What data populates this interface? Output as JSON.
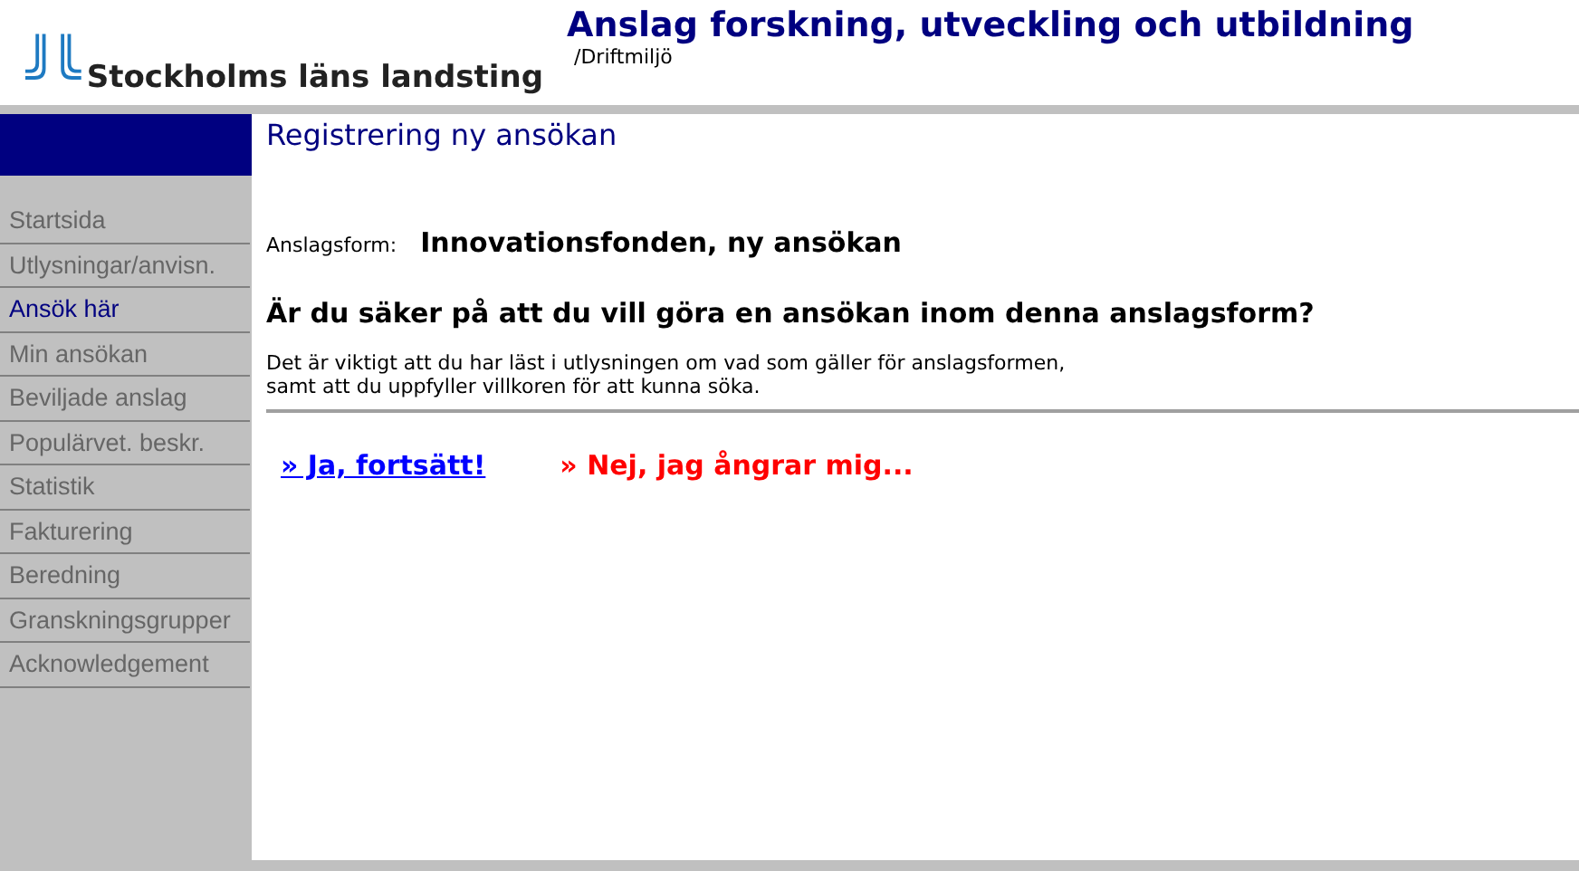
{
  "header": {
    "logo_text": "Stockholms läns landsting",
    "title": "Anslag forskning, utveckling och utbildning",
    "environment": "/Driftmiljö"
  },
  "sidebar": {
    "items": [
      {
        "label": "Startsida",
        "selected": false
      },
      {
        "label": "Utlysningar/anvisn.",
        "selected": false
      },
      {
        "label": "Ansök här",
        "selected": true
      },
      {
        "label": "Min ansökan",
        "selected": false
      },
      {
        "label": "Beviljade anslag",
        "selected": false
      },
      {
        "label": "Populärvet. beskr.",
        "selected": false
      },
      {
        "label": "Statistik",
        "selected": false
      },
      {
        "label": "Fakturering",
        "selected": false
      },
      {
        "label": "Beredning",
        "selected": false
      },
      {
        "label": "Granskningsgrupper",
        "selected": false
      },
      {
        "label": "Acknowledgement",
        "selected": false
      }
    ]
  },
  "page": {
    "heading": "Registrering ny ansökan",
    "grant_label": "Anslagsform:",
    "grant_value": "Innovationsfonden, ny ansökan",
    "question": "Är du säker på att du vill göra en ansökan inom denna anslagsform?",
    "info_lines": [
      "Det är viktigt att du har läst i utlysningen om vad som gäller för anslagsformen,",
      "samt att du uppfyller villkoren för att kunna söka."
    ],
    "actions": [
      {
        "label": "» Ja, fortsätt!",
        "kind": "confirm"
      },
      {
        "label": "» Nej, jag ångrar mig...",
        "kind": "cancel"
      }
    ]
  }
}
